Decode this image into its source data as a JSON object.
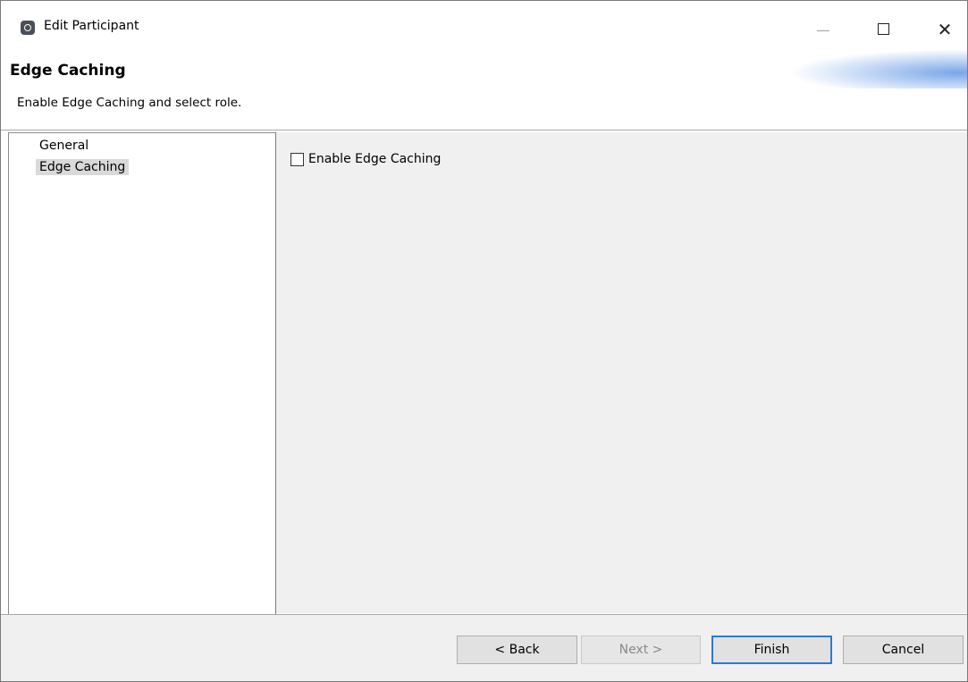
{
  "window": {
    "title": "Edit Participant",
    "minimize_icon": "minimize-icon",
    "maximize_icon": "maximize-icon",
    "close_icon": "close-icon",
    "close_glyph": "✕"
  },
  "header": {
    "title": "Edge Caching",
    "description": "Enable Edge Caching and select role."
  },
  "nav": {
    "items": [
      {
        "label": "General",
        "selected": false
      },
      {
        "label": "Edge Caching",
        "selected": true
      }
    ]
  },
  "content": {
    "enable_checkbox": {
      "label": "Enable Edge Caching",
      "checked": false
    }
  },
  "footer": {
    "back_label": "< Back",
    "next_label": "Next >",
    "finish_label": "Finish",
    "cancel_label": "Cancel",
    "next_enabled": false,
    "default_button": "Finish"
  },
  "colors": {
    "accent": "#2c7ad6",
    "panel_bg": "#f0f0f0",
    "selection_bg": "#d9d9d9"
  }
}
